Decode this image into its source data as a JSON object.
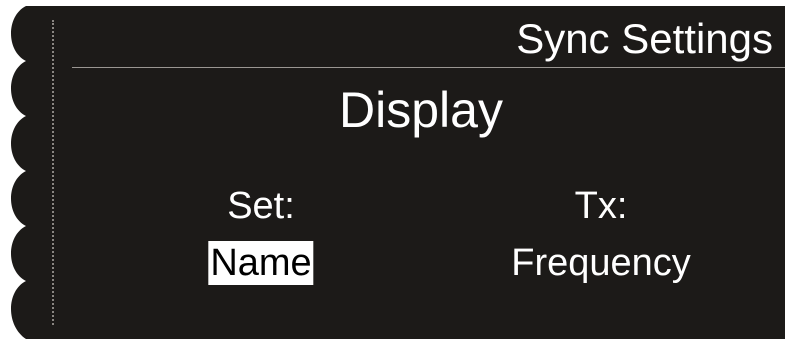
{
  "header": {
    "title": "Sync Settings"
  },
  "page": {
    "title": "Display"
  },
  "settings": {
    "set_label": "Set:",
    "set_value": "Name",
    "tx_label": "Tx:",
    "tx_value": "Frequency"
  },
  "colors": {
    "background": "#1c1a18",
    "text": "#ffffff",
    "highlight_bg": "#ffffff",
    "highlight_text": "#000000"
  }
}
